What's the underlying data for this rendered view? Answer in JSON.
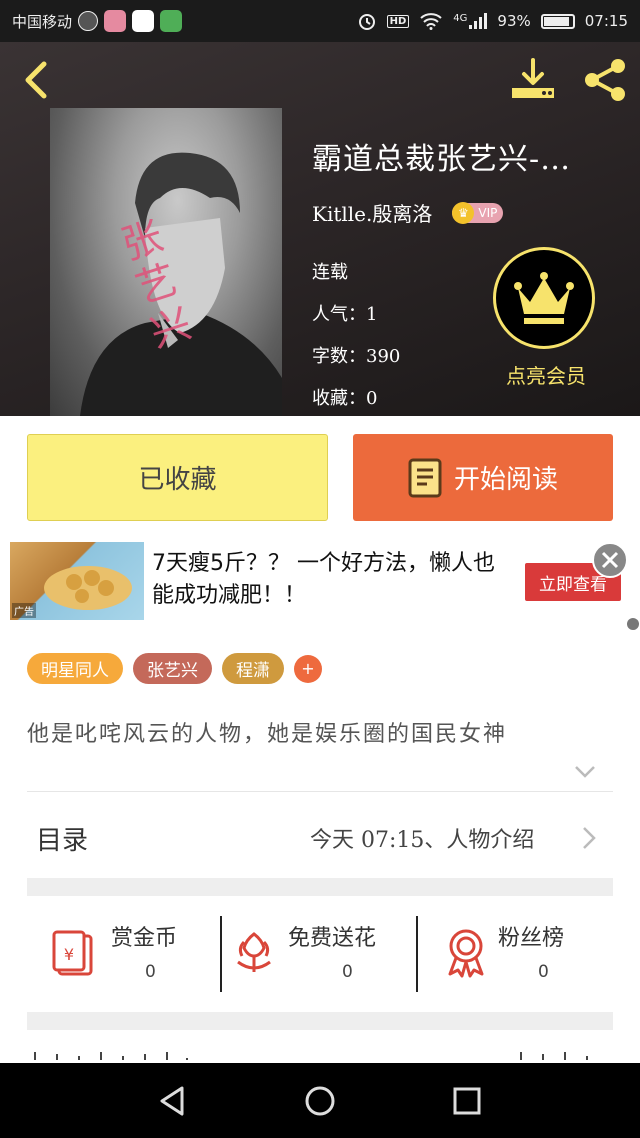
{
  "status_bar": {
    "carrier": "中国移动",
    "hd": "HD",
    "network": "4G",
    "battery": "93%",
    "time": "07:15"
  },
  "book": {
    "title": "霸道总裁张艺兴-…",
    "author": "Kitlle.殷离洛",
    "vip_label": "VIP",
    "status": "连载",
    "popularity_label": "人气：1",
    "word_count_label": "字数：390",
    "favorites_label": "收藏：0",
    "cover_overlay_text": "张艺兴"
  },
  "member": {
    "label": "点亮会员"
  },
  "actions": {
    "collected_label": "已收藏",
    "read_label": "开始阅读"
  },
  "ad": {
    "image_tag": "广告",
    "text": "7天瘦5斤？？ 一个好方法，懒人也能成功减肥！！",
    "cta": "立即查看"
  },
  "tags": [
    {
      "label": "明星同人",
      "color": "#f6a93b"
    },
    {
      "label": "张艺兴",
      "color": "#c4695a"
    },
    {
      "label": "程潇",
      "color": "#cf9a3e"
    }
  ],
  "tag_add": "+",
  "description": "他是叱咤风云的人物，她是娱乐圈的国民女神",
  "toc": {
    "title": "目录",
    "latest": "今天 07:15、人物介绍"
  },
  "stats": [
    {
      "label": "赏金币",
      "value": "0",
      "icon": "red-envelope-icon"
    },
    {
      "label": "免费送花",
      "value": "0",
      "icon": "flower-icon"
    },
    {
      "label": "粉丝榜",
      "value": "0",
      "icon": "medal-icon"
    }
  ],
  "colors": {
    "accent_yellow": "#f7e36c",
    "accent_orange": "#ec6a3c",
    "icon_red": "#d9463a"
  }
}
